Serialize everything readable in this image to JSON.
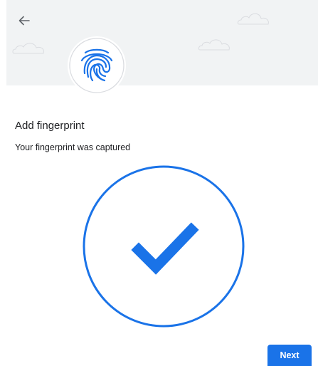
{
  "header": {
    "back_icon": "arrow-left-icon",
    "badge_icon": "fingerprint-icon"
  },
  "content": {
    "title": "Add fingerprint",
    "subtitle": "Your fingerprint was captured",
    "status_icon": "checkmark-circle-icon"
  },
  "footer": {
    "next_label": "Next"
  },
  "colors": {
    "accent": "#1a73e8",
    "banner_background": "#f1f3f4",
    "text": "#202124",
    "icon_gray": "#5f6368"
  }
}
